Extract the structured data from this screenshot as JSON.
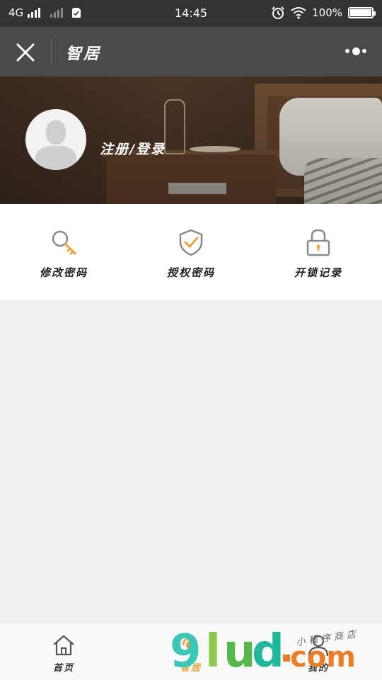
{
  "status_bar": {
    "network": "4G",
    "time": "14:45",
    "battery_text": "100%",
    "battery_level": 1.0
  },
  "nav": {
    "title": "智居",
    "close_icon": "close-icon",
    "more_icon": "more-dots-icon"
  },
  "banner": {
    "login_text": "注册/登录"
  },
  "functions": [
    {
      "label": "修改密码",
      "icon": "key-search-icon"
    },
    {
      "label": "授权密码",
      "icon": "shield-check-icon"
    },
    {
      "label": "开锁记录",
      "icon": "padlock-icon"
    }
  ],
  "tabs": [
    {
      "label": "首页",
      "icon": "home-icon",
      "active": false
    },
    {
      "label": "智居",
      "icon": "smart-home-icon",
      "active": true
    },
    {
      "label": "我的",
      "icon": "user-icon",
      "active": false
    }
  ],
  "watermark": {
    "site_9": "9",
    "site_l": "l",
    "site_u": "u",
    "site_d": "d",
    "site_com": "com",
    "site_cn": "小程序商店"
  },
  "colors": {
    "accent": "#e8a23c",
    "nav_bg": "#4a4a4a",
    "status_bg": "#333333",
    "page_bg": "#f1f1f1"
  }
}
